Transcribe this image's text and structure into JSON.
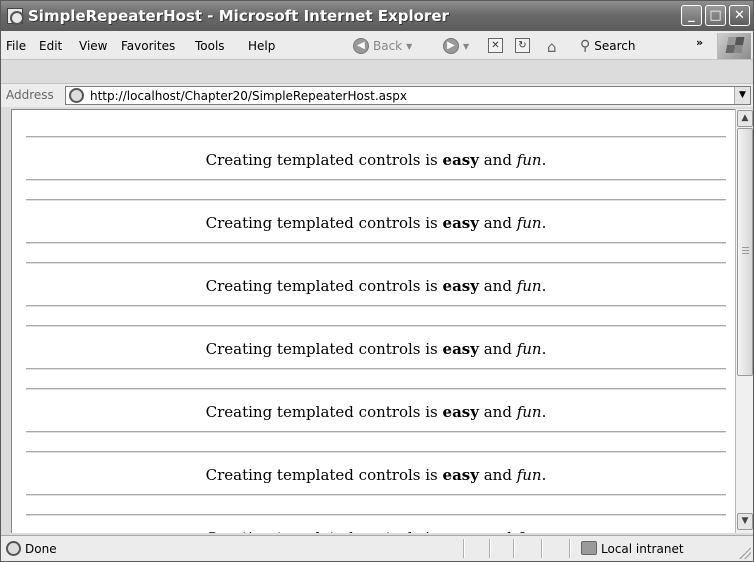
{
  "window": {
    "title": "SimpleRepeaterHost - Microsoft Internet Explorer",
    "min": "_",
    "max": "□",
    "close": "✕"
  },
  "menu": {
    "items": [
      "File",
      "Edit",
      "View",
      "Favorites",
      "Tools",
      "Help"
    ]
  },
  "toolbar": {
    "back_label": "Back",
    "search_label": "Search",
    "overflow": "»"
  },
  "address": {
    "label": "Address",
    "url": "http://localhost/Chapter20/SimpleRepeaterHost.aspx"
  },
  "items": [
    {
      "prefix": "Creating templated controls is ",
      "bold": "easy",
      "mid": " and ",
      "italic": "fun",
      "suffix": "."
    },
    {
      "prefix": "Creating templated controls is ",
      "bold": "easy",
      "mid": " and ",
      "italic": "fun",
      "suffix": "."
    },
    {
      "prefix": "Creating templated controls is ",
      "bold": "easy",
      "mid": " and ",
      "italic": "fun",
      "suffix": "."
    },
    {
      "prefix": "Creating templated controls is ",
      "bold": "easy",
      "mid": " and ",
      "italic": "fun",
      "suffix": "."
    },
    {
      "prefix": "Creating templated controls is ",
      "bold": "easy",
      "mid": " and ",
      "italic": "fun",
      "suffix": "."
    },
    {
      "prefix": "Creating templated controls is ",
      "bold": "easy",
      "mid": " and ",
      "italic": "fun",
      "suffix": "."
    },
    {
      "prefix": "Creating templated controls is ",
      "bold": "easy",
      "mid": " and ",
      "italic": "fun",
      "suffix": "."
    }
  ],
  "status": {
    "text": "Done",
    "zone": "Local intranet"
  }
}
